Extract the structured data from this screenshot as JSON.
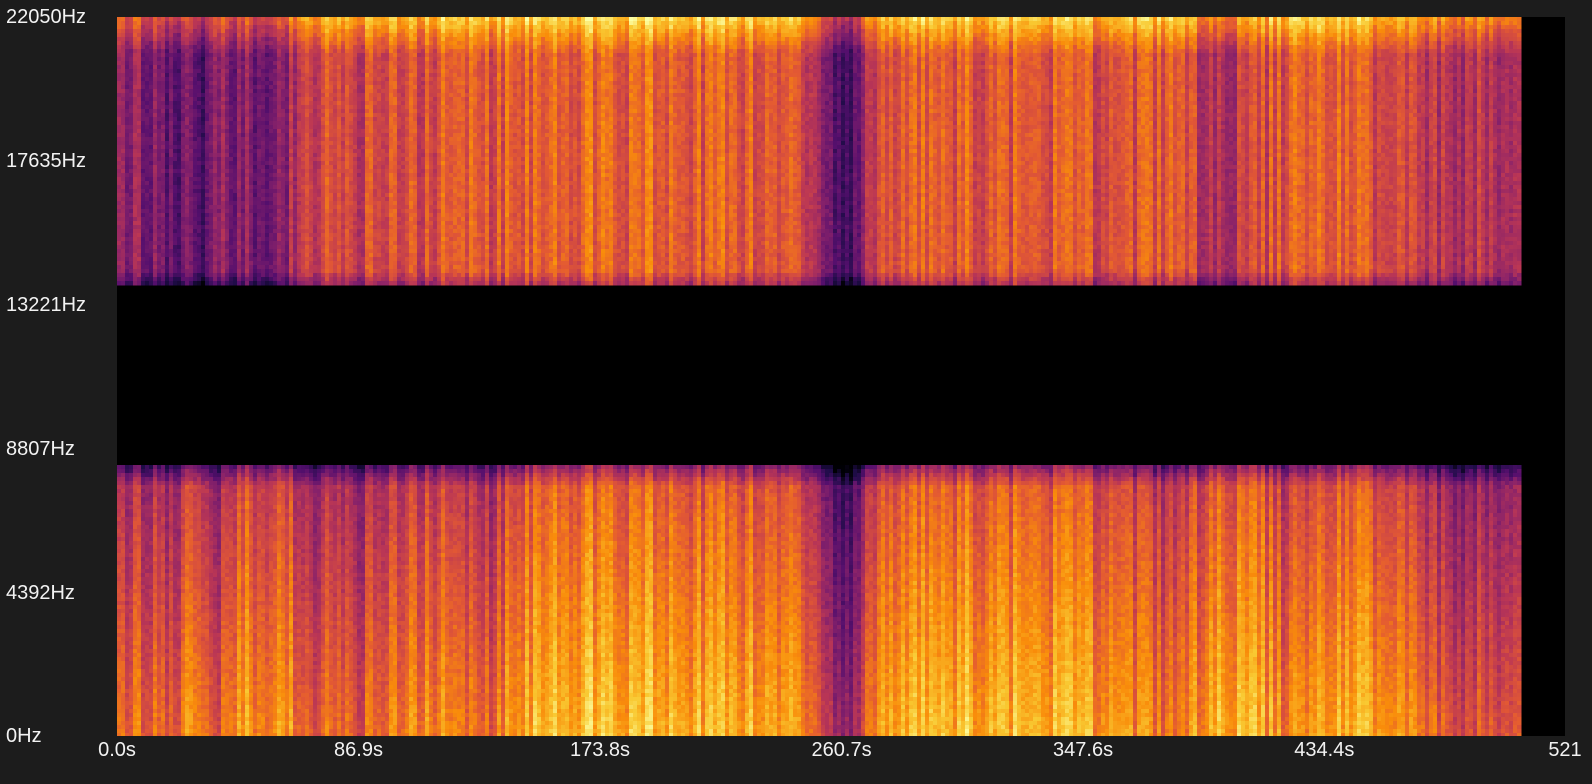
{
  "chart_data": {
    "type": "heatmap",
    "colormap": "inferno",
    "background": "#1c1c1c",
    "x_unit": "s",
    "y_unit": "Hz",
    "xlim": [
      0,
      521
    ],
    "ylim": [
      0,
      22050
    ],
    "x_ticks": [
      "0.0s",
      "86.9s",
      "173.8s",
      "260.7s",
      "347.6s",
      "434.4s",
      "521"
    ],
    "x_tick_values": [
      0,
      86.9,
      173.8,
      260.7,
      347.6,
      434.4,
      521
    ],
    "y_ticks": [
      "0Hz",
      "4392Hz",
      "8807Hz",
      "13221Hz",
      "17635Hz",
      "22050Hz"
    ],
    "y_tick_values": [
      0,
      4392,
      8807,
      13221,
      17635,
      22050
    ],
    "silent_band_hz": [
      8300,
      13780
    ],
    "audio_end_s": 505,
    "time_s": [
      0,
      20,
      30,
      35,
      40,
      60,
      66,
      90,
      110,
      130,
      150,
      200,
      240,
      258,
      265,
      275,
      300,
      340,
      360,
      380,
      395,
      410,
      420,
      450,
      470,
      485,
      500,
      505
    ],
    "lower_band_intensity": [
      0.45,
      0.45,
      0.55,
      0.3,
      0.55,
      0.58,
      0.45,
      0.42,
      0.55,
      0.42,
      0.65,
      0.62,
      0.62,
      0.25,
      0.25,
      0.62,
      0.62,
      0.62,
      0.55,
      0.45,
      0.62,
      0.6,
      0.5,
      0.62,
      0.45,
      0.38,
      0.45,
      0.4
    ],
    "upper_band_intensity": [
      0.4,
      0.32,
      0.25,
      0.38,
      0.35,
      0.38,
      0.58,
      0.55,
      0.6,
      0.6,
      0.66,
      0.64,
      0.65,
      0.28,
      0.28,
      0.63,
      0.62,
      0.62,
      0.58,
      0.62,
      0.45,
      0.55,
      0.62,
      0.62,
      0.5,
      0.5,
      0.52,
      0.45
    ]
  }
}
